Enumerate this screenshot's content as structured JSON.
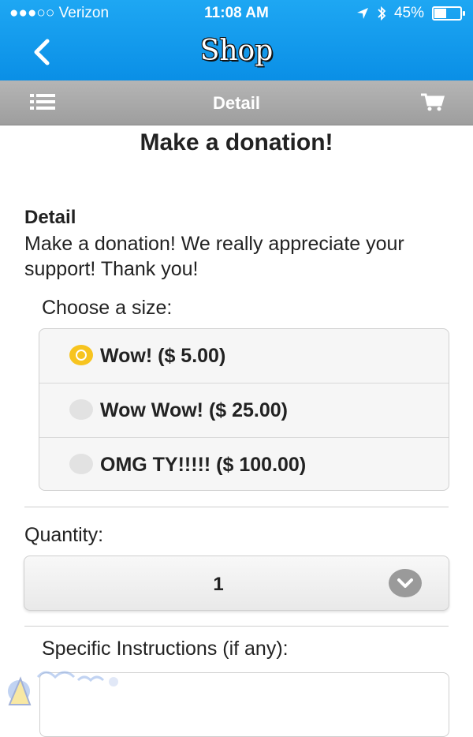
{
  "status_bar": {
    "carrier": "●●●○○ Verizon",
    "time": "11:08 AM",
    "battery": "45%",
    "battery_level": 0.45
  },
  "nav": {
    "title": "Shop",
    "back_icon": "chevron-left-icon"
  },
  "subbar": {
    "title": "Detail",
    "menu_icon": "list-icon",
    "cart_icon": "cart-icon"
  },
  "product": {
    "heading": "Make a donation!",
    "detail_label": "Detail",
    "detail_text": "Make a donation! We really appreciate your support! Thank you!"
  },
  "size": {
    "label": "Choose a size:",
    "options": [
      {
        "label": "Wow! ($ 5.00)",
        "selected": true
      },
      {
        "label": "Wow Wow! ($ 25.00)",
        "selected": false
      },
      {
        "label": "OMG TY!!!!! ($ 100.00)",
        "selected": false
      }
    ]
  },
  "quantity": {
    "label": "Quantity:",
    "value": "1"
  },
  "instructions": {
    "label": "Specific Instructions (if any):",
    "value": ""
  },
  "colors": {
    "header_blue": "#0a8fe6",
    "subbar_gray": "#9e9e9e",
    "radio_selected": "#f7c41f"
  }
}
